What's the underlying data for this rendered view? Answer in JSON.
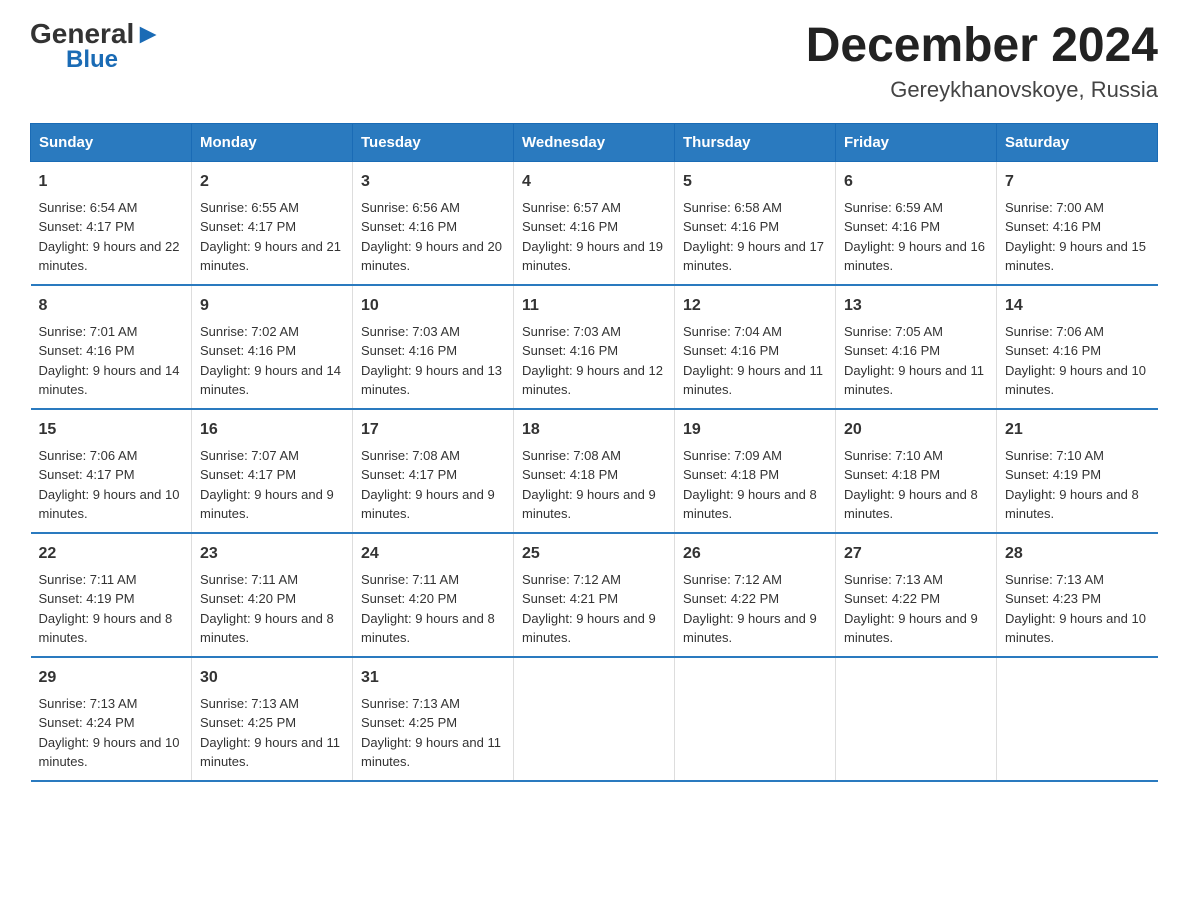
{
  "logo": {
    "general": "General",
    "triangle": "▲",
    "blue": "Blue"
  },
  "title": "December 2024",
  "subtitle": "Gereykhanovskoye, Russia",
  "headers": [
    "Sunday",
    "Monday",
    "Tuesday",
    "Wednesday",
    "Thursday",
    "Friday",
    "Saturday"
  ],
  "weeks": [
    [
      {
        "day": "1",
        "sunrise": "6:54 AM",
        "sunset": "4:17 PM",
        "daylight": "9 hours and 22 minutes."
      },
      {
        "day": "2",
        "sunrise": "6:55 AM",
        "sunset": "4:17 PM",
        "daylight": "9 hours and 21 minutes."
      },
      {
        "day": "3",
        "sunrise": "6:56 AM",
        "sunset": "4:16 PM",
        "daylight": "9 hours and 20 minutes."
      },
      {
        "day": "4",
        "sunrise": "6:57 AM",
        "sunset": "4:16 PM",
        "daylight": "9 hours and 19 minutes."
      },
      {
        "day": "5",
        "sunrise": "6:58 AM",
        "sunset": "4:16 PM",
        "daylight": "9 hours and 17 minutes."
      },
      {
        "day": "6",
        "sunrise": "6:59 AM",
        "sunset": "4:16 PM",
        "daylight": "9 hours and 16 minutes."
      },
      {
        "day": "7",
        "sunrise": "7:00 AM",
        "sunset": "4:16 PM",
        "daylight": "9 hours and 15 minutes."
      }
    ],
    [
      {
        "day": "8",
        "sunrise": "7:01 AM",
        "sunset": "4:16 PM",
        "daylight": "9 hours and 14 minutes."
      },
      {
        "day": "9",
        "sunrise": "7:02 AM",
        "sunset": "4:16 PM",
        "daylight": "9 hours and 14 minutes."
      },
      {
        "day": "10",
        "sunrise": "7:03 AM",
        "sunset": "4:16 PM",
        "daylight": "9 hours and 13 minutes."
      },
      {
        "day": "11",
        "sunrise": "7:03 AM",
        "sunset": "4:16 PM",
        "daylight": "9 hours and 12 minutes."
      },
      {
        "day": "12",
        "sunrise": "7:04 AM",
        "sunset": "4:16 PM",
        "daylight": "9 hours and 11 minutes."
      },
      {
        "day": "13",
        "sunrise": "7:05 AM",
        "sunset": "4:16 PM",
        "daylight": "9 hours and 11 minutes."
      },
      {
        "day": "14",
        "sunrise": "7:06 AM",
        "sunset": "4:16 PM",
        "daylight": "9 hours and 10 minutes."
      }
    ],
    [
      {
        "day": "15",
        "sunrise": "7:06 AM",
        "sunset": "4:17 PM",
        "daylight": "9 hours and 10 minutes."
      },
      {
        "day": "16",
        "sunrise": "7:07 AM",
        "sunset": "4:17 PM",
        "daylight": "9 hours and 9 minutes."
      },
      {
        "day": "17",
        "sunrise": "7:08 AM",
        "sunset": "4:17 PM",
        "daylight": "9 hours and 9 minutes."
      },
      {
        "day": "18",
        "sunrise": "7:08 AM",
        "sunset": "4:18 PM",
        "daylight": "9 hours and 9 minutes."
      },
      {
        "day": "19",
        "sunrise": "7:09 AM",
        "sunset": "4:18 PM",
        "daylight": "9 hours and 8 minutes."
      },
      {
        "day": "20",
        "sunrise": "7:10 AM",
        "sunset": "4:18 PM",
        "daylight": "9 hours and 8 minutes."
      },
      {
        "day": "21",
        "sunrise": "7:10 AM",
        "sunset": "4:19 PM",
        "daylight": "9 hours and 8 minutes."
      }
    ],
    [
      {
        "day": "22",
        "sunrise": "7:11 AM",
        "sunset": "4:19 PM",
        "daylight": "9 hours and 8 minutes."
      },
      {
        "day": "23",
        "sunrise": "7:11 AM",
        "sunset": "4:20 PM",
        "daylight": "9 hours and 8 minutes."
      },
      {
        "day": "24",
        "sunrise": "7:11 AM",
        "sunset": "4:20 PM",
        "daylight": "9 hours and 8 minutes."
      },
      {
        "day": "25",
        "sunrise": "7:12 AM",
        "sunset": "4:21 PM",
        "daylight": "9 hours and 9 minutes."
      },
      {
        "day": "26",
        "sunrise": "7:12 AM",
        "sunset": "4:22 PM",
        "daylight": "9 hours and 9 minutes."
      },
      {
        "day": "27",
        "sunrise": "7:13 AM",
        "sunset": "4:22 PM",
        "daylight": "9 hours and 9 minutes."
      },
      {
        "day": "28",
        "sunrise": "7:13 AM",
        "sunset": "4:23 PM",
        "daylight": "9 hours and 10 minutes."
      }
    ],
    [
      {
        "day": "29",
        "sunrise": "7:13 AM",
        "sunset": "4:24 PM",
        "daylight": "9 hours and 10 minutes."
      },
      {
        "day": "30",
        "sunrise": "7:13 AM",
        "sunset": "4:25 PM",
        "daylight": "9 hours and 11 minutes."
      },
      {
        "day": "31",
        "sunrise": "7:13 AM",
        "sunset": "4:25 PM",
        "daylight": "9 hours and 11 minutes."
      },
      null,
      null,
      null,
      null
    ]
  ],
  "colors": {
    "header_bg": "#2a7abf",
    "header_text": "#ffffff",
    "border": "#2a7abf"
  }
}
